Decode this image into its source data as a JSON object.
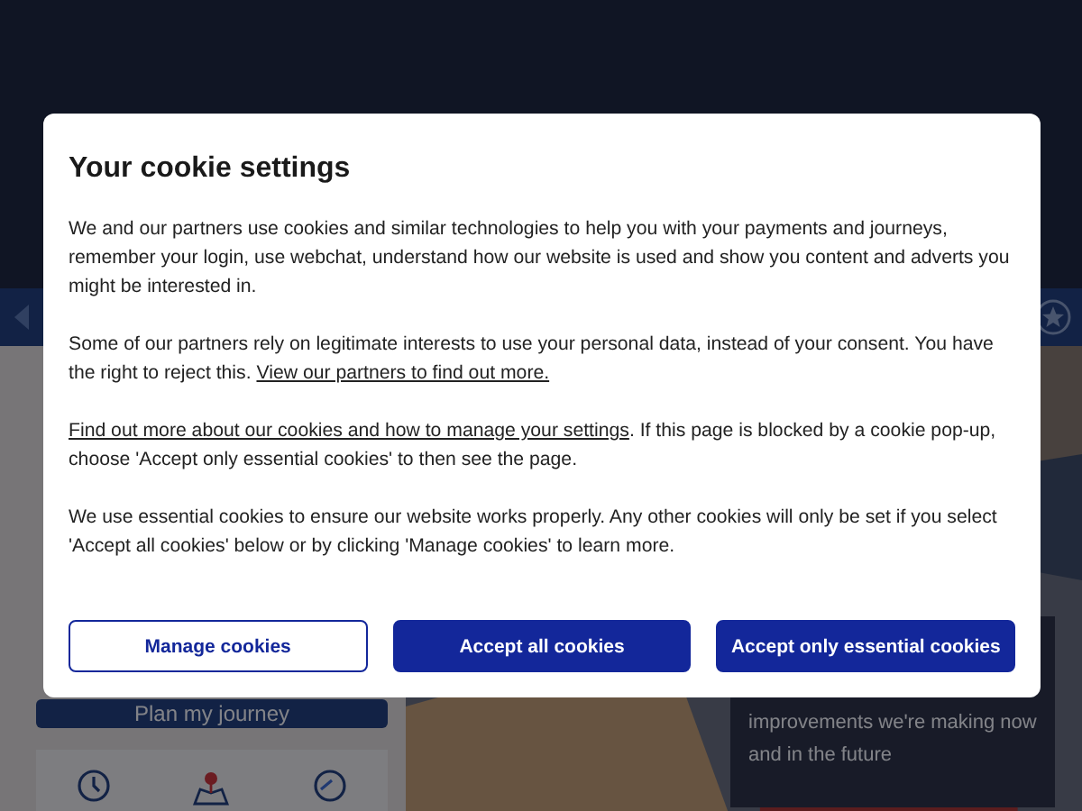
{
  "page": {
    "plan_button": "Plan my journey",
    "promo_text": "improvements we're making now and in the future"
  },
  "dialog": {
    "title": "Your cookie settings",
    "paragraphs": [
      [
        {
          "kind": "text",
          "text": "We and our partners use cookies and similar technologies to help you with your payments and journeys, remember your login, use webchat, understand how our website is used and show you content and adverts you might be interested in."
        }
      ],
      [
        {
          "kind": "text",
          "text": "Some of our partners rely on legitimate interests to use your personal data, instead of your consent. You have the right to reject this. "
        },
        {
          "kind": "link",
          "text": "View our partners to find out more."
        }
      ],
      [
        {
          "kind": "link",
          "text": "Find out more about our cookies and how to manage your settings"
        },
        {
          "kind": "text",
          "text": ". If this page is blocked by a cookie pop-up, choose 'Accept only essential cookies' to then see the page."
        }
      ],
      [
        {
          "kind": "text",
          "text": "We use essential cookies to ensure our website works properly. Any other cookies will only be set if you select 'Accept all cookies' below or by clicking 'Manage cookies' to learn more."
        }
      ]
    ],
    "buttons": [
      {
        "label": "Manage cookies",
        "kind": "outline"
      },
      {
        "label": "Accept all cookies",
        "kind": "filled"
      },
      {
        "label": "Accept only essential cookies",
        "kind": "filled"
      }
    ]
  }
}
